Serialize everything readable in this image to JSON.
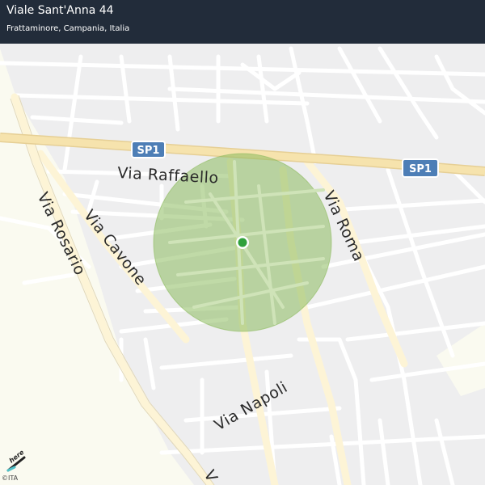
{
  "header": {
    "title": "Viale Sant'Anna 44",
    "subtitle": "Frattaminore, Campania, Italia"
  },
  "map": {
    "road_labels": {
      "via_raffaello": "Via  Raffaello",
      "via_roma": "Via  Roma",
      "via_rosario": "Via  Rosario",
      "via_cavone": "Via  Cavone",
      "via_napoli": "Via  Napoli",
      "edge_v": "V"
    },
    "shields": [
      "SP1",
      "SP1"
    ],
    "location_marker": "current-location",
    "accuracy_circle": "location-accuracy",
    "colors": {
      "background": "#eeeeef",
      "green_area": "#fafaf0",
      "local_street": "#ffffff",
      "main_road": "#fdf4d6",
      "highway": "#f6e3ad",
      "accuracy_fill": "#8dbb5f",
      "marker": "#2fa13c",
      "shield": "#4d7eb6",
      "header": "#222c3a"
    }
  },
  "attribution": {
    "logo": "here",
    "copyright": "©ITA"
  }
}
